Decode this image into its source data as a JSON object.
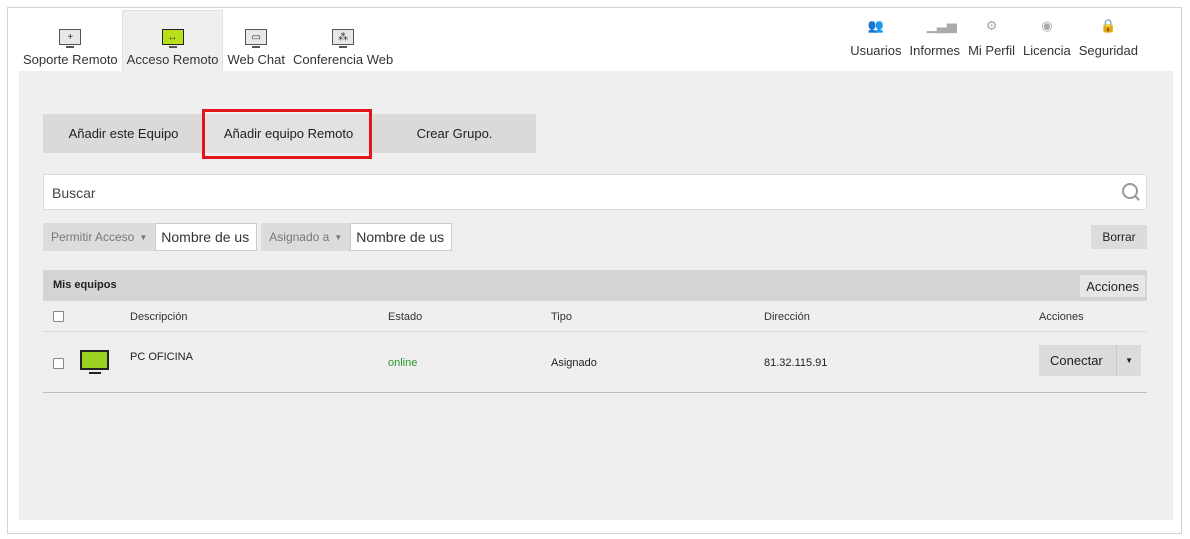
{
  "nav": {
    "left": [
      {
        "label": "Soporte Remoto",
        "icon": "remote-support-icon"
      },
      {
        "label": "Acceso Remoto",
        "icon": "remote-access-icon",
        "active": true
      },
      {
        "label": "Web Chat",
        "icon": "web-chat-icon"
      },
      {
        "label": "Conferencia Web",
        "icon": "web-conference-icon"
      }
    ],
    "right": [
      {
        "label": "Usuarios",
        "icon": "users-icon"
      },
      {
        "label": "Informes",
        "icon": "reports-icon"
      },
      {
        "label": "Mi Perfil",
        "icon": "gear-icon"
      },
      {
        "label": "Licencia",
        "icon": "license-icon"
      },
      {
        "label": "Seguridad",
        "icon": "lock-icon"
      }
    ]
  },
  "toolbar": {
    "add_this": "Añadir este Equipo",
    "add_remote": "Añadir equipo Remoto",
    "create_group": "Crear Grupo."
  },
  "search": {
    "placeholder": "Buscar"
  },
  "filters": {
    "access_label": "Permitir Acceso",
    "user_placeholder_1": "Nombre de us",
    "assigned_label": "Asignado a",
    "user_placeholder_2": "Nombre de us",
    "clear_label": "Borrar"
  },
  "table": {
    "title": "Mis equipos",
    "actions_button": "Acciones",
    "columns": {
      "description": "Descripción",
      "state": "Estado",
      "type": "Tipo",
      "address": "Dirección",
      "actions": "Acciones"
    },
    "rows": [
      {
        "description": "PC OFICINA",
        "state": "online",
        "type": "Asignado",
        "address": "81.32.115.91",
        "action": "Conectar"
      }
    ]
  },
  "colors": {
    "accent_green": "#9ad21f",
    "online": "#2a9a2a",
    "highlight": "#e3151a"
  }
}
